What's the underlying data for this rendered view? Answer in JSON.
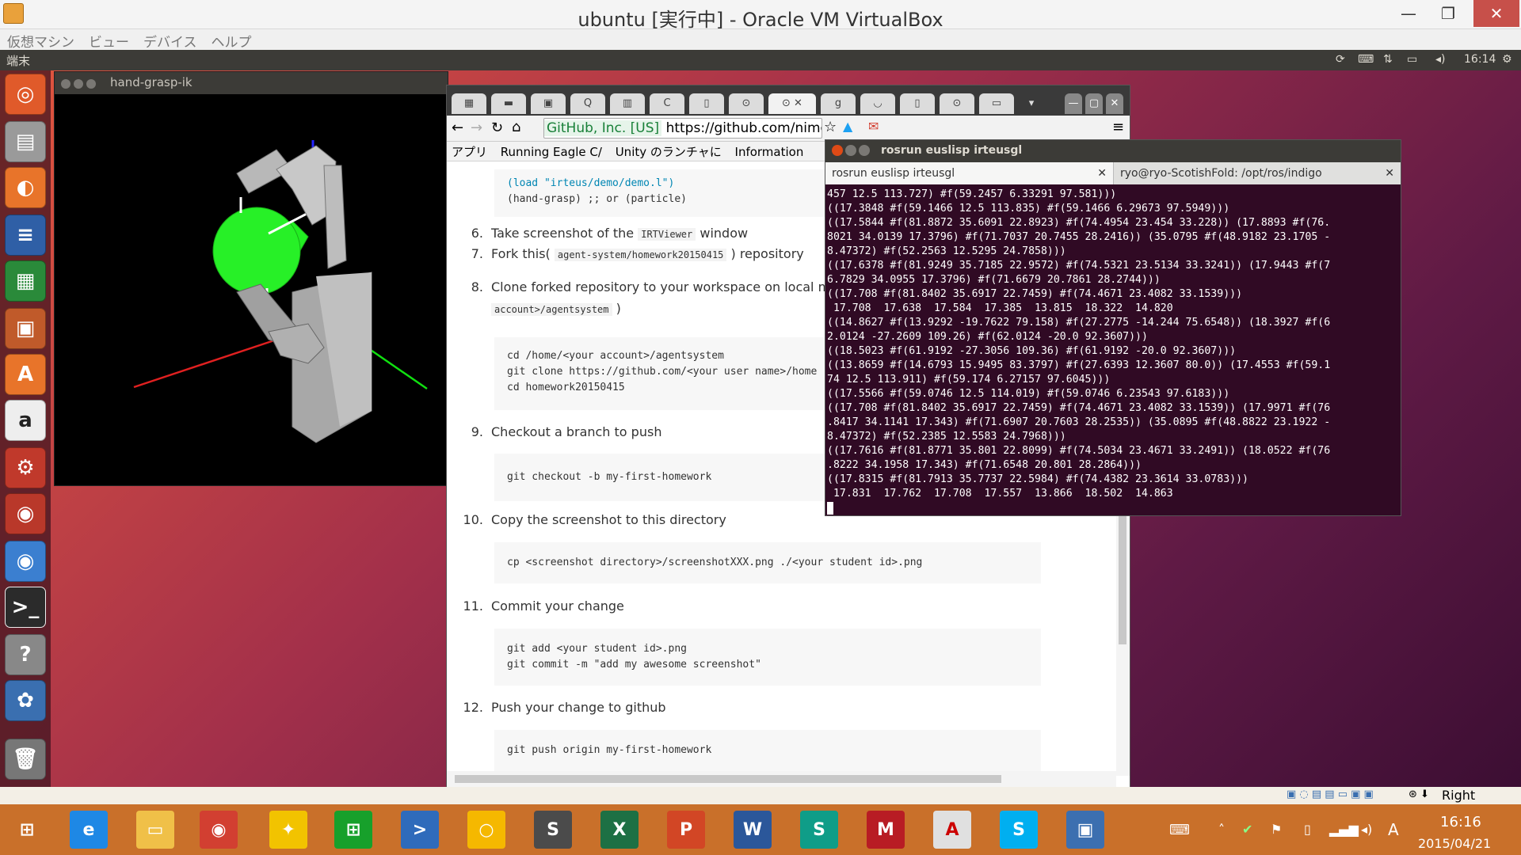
{
  "vbox": {
    "title": "ubuntu [実行中] - Oracle VM VirtualBox",
    "menu": [
      "仮想マシン",
      "ビュー",
      "デバイス",
      "ヘルプ"
    ],
    "controls": [
      "—",
      "❐",
      "✕"
    ]
  },
  "panel": {
    "app_name": "端末",
    "clock": "16:14",
    "indicators": [
      "sync-icon",
      "keyboard-icon",
      "network-icon",
      "battery-icon",
      "volume-icon",
      "gear-icon"
    ]
  },
  "launcher": {
    "items": [
      "ubuntu-dash-icon",
      "files-icon",
      "firefox-icon",
      "writer-icon",
      "calc-icon",
      "impress-icon",
      "software-center-icon",
      "amazon-icon",
      "settings-icon",
      "chrome-icon",
      "chromium-icon",
      "terminal-icon",
      "help-icon",
      "shotwell-icon",
      "trash-icon"
    ]
  },
  "ik_window": {
    "title": "hand-grasp-ik"
  },
  "chrome": {
    "url_secure_label": "GitHub, Inc. [US]",
    "url": "https://github.com/nimor",
    "bookmarks": [
      "アプリ",
      "Running Eagle C/",
      "Unity のランチャに",
      "Information"
    ],
    "code_top": [
      "(load \"irteus/demo/demo.l\")",
      "(hand-grasp) ;; or (particle)"
    ],
    "steps": [
      {
        "num": "6.",
        "text": "Take screenshot of the",
        "code": "IRTViewer",
        "text2": "window"
      },
      {
        "num": "7.",
        "text": "Fork this(",
        "code": "agent-system/homework20150415",
        "text2": ") repository"
      },
      {
        "num": "8.",
        "text": "Clone forked repository to your workspace on local machine",
        "code": "account>/agentsystem",
        "text2": ")"
      },
      {
        "num": "9.",
        "text": "Checkout a branch to push"
      },
      {
        "num": "10.",
        "text": "Copy the screenshot to this directory"
      },
      {
        "num": "11.",
        "text": "Commit your change"
      },
      {
        "num": "12.",
        "text": "Push your change to github"
      }
    ],
    "code_clone": [
      "cd /home/<your account>/agentsystem",
      "git clone https://github.com/<your user name>/home",
      "cd homework20150415"
    ],
    "code_checkout": "git checkout -b my-first-homework",
    "code_copy": "cp <screenshot directory>/screenshotXXX.png ./<your student id>.png",
    "code_commit": [
      "git add <your student id>.png",
      "git commit -m \"add my awesome screenshot\""
    ],
    "code_push": "git push origin my-first-homework"
  },
  "terminal": {
    "title": "rosrun euslisp irteusgl",
    "tabs": [
      "rosrun euslisp irteusgl",
      "ryo@ryo-ScotishFold: /opt/ros/indigo"
    ],
    "lines": [
      "457 12.5 113.727) #f(59.2457 6.33291 97.581)))",
      "((17.3848 #f(59.1466 12.5 113.835) #f(59.1466 6.29673 97.5949)))",
      "((17.5844 #f(81.8872 35.6091 22.8923) #f(74.4954 23.454 33.228)) (17.8893 #f(76.",
      "8021 34.0139 17.3796) #f(71.7037 20.7455 28.2416)) (35.0795 #f(48.9182 23.1705 -",
      "8.47372) #f(52.2563 12.5295 24.7858)))",
      "((17.6378 #f(81.9249 35.7185 22.9572) #f(74.5321 23.5134 33.3241)) (17.9443 #f(7",
      "6.7829 34.0955 17.3796) #f(71.6679 20.7861 28.2744)))",
      "((17.708 #f(81.8402 35.6917 22.7459) #f(74.4671 23.4082 33.1539)))",
      " 17.708  17.638  17.584  17.385  13.815  18.322  14.820",
      "((14.8627 #f(13.9292 -19.7622 79.158) #f(27.2775 -14.244 75.6548)) (18.3927 #f(6",
      "2.0124 -27.2609 109.26) #f(62.0124 -20.0 92.3607)))",
      "((18.5023 #f(61.9192 -27.3056 109.36) #f(61.9192 -20.0 92.3607)))",
      "((13.8659 #f(14.6793 15.9495 83.3797) #f(27.6393 12.3607 80.0)) (17.4553 #f(59.1",
      "74 12.5 113.911) #f(59.174 6.27157 97.6045)))",
      "((17.5566 #f(59.0746 12.5 114.019) #f(59.0746 6.23543 97.6183)))",
      "((17.708 #f(81.8402 35.6917 22.7459) #f(74.4671 23.4082 33.1539)) (17.9971 #f(76",
      ".8417 34.1141 17.343) #f(71.6907 20.7603 28.2535)) (35.0895 #f(48.8822 23.1922 -",
      "8.47372) #f(52.2385 12.5583 24.7968)))",
      "((17.7616 #f(81.8771 35.801 22.8099) #f(74.5034 23.4671 33.2491)) (18.0522 #f(76",
      ".8222 34.1958 17.343) #f(71.6548 20.801 28.2864)))",
      "((17.8315 #f(81.7913 35.7737 22.5984) #f(74.4382 23.3614 33.0783)))",
      " 17.831  17.762  17.708  17.557  13.866  18.502  14.863"
    ]
  },
  "taskbar": {
    "tray_label": "Right Control",
    "time": "16:16",
    "date": "2015/04/21",
    "ime": "A",
    "apps": [
      {
        "name": "start-icon",
        "glyph": "⊞",
        "color": "#c9702a"
      },
      {
        "name": "internet-explorer-icon",
        "glyph": "e",
        "color": "#1e88e5"
      },
      {
        "name": "file-explorer-icon",
        "glyph": "▭",
        "color": "#f0c048"
      },
      {
        "name": "chrome-icon",
        "glyph": "◉",
        "color": "#d23f31"
      },
      {
        "name": "lightbulb-icon",
        "glyph": "✦",
        "color": "#f2c300"
      },
      {
        "name": "store-icon",
        "glyph": "⊞",
        "color": "#17a02b"
      },
      {
        "name": "powershell-icon",
        "glyph": ">",
        "color": "#2f6bbb"
      },
      {
        "name": "circle-app-icon",
        "glyph": "○",
        "color": "#f5b800"
      },
      {
        "name": "sublime-icon",
        "glyph": "S",
        "color": "#4b4b4b"
      },
      {
        "name": "excel-icon",
        "glyph": "X",
        "color": "#1d7044"
      },
      {
        "name": "powerpoint-icon",
        "glyph": "P",
        "color": "#d24625"
      },
      {
        "name": "word-icon",
        "glyph": "W",
        "color": "#2b579a"
      },
      {
        "name": "sway-icon",
        "glyph": "S",
        "color": "#0f9d88"
      },
      {
        "name": "mendeley-icon",
        "glyph": "M",
        "color": "#b81c24"
      },
      {
        "name": "acrobat-icon",
        "glyph": "A",
        "color": "#e0e0e0"
      },
      {
        "name": "skype-icon",
        "glyph": "S",
        "color": "#00aff0"
      },
      {
        "name": "virtualbox-icon",
        "glyph": "▣",
        "color": "#3c6fb0"
      }
    ]
  },
  "colors": {
    "terminal_bg": "#300a24",
    "panel_bg": "#3c3b37",
    "taskbar": "#c9702a"
  }
}
